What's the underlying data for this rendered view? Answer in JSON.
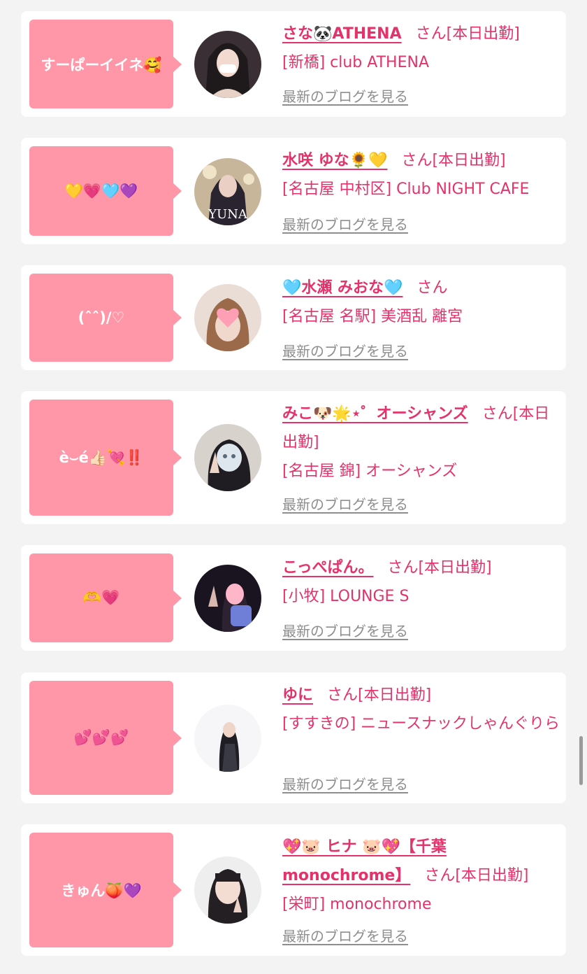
{
  "cards": [
    {
      "bubble": "すーぱーイイネ🥰",
      "name": "さな🐼ATHENA",
      "san": "さん[本日出勤]",
      "shop": "[新橋] club ATHENA",
      "blog": "最新のブログを見る"
    },
    {
      "bubble": "💛💗🩵💜",
      "name": "水咲 ゆな🌻💛",
      "san": "さん[本日出勤]",
      "shop": "[名古屋 中村区] Club NIGHT CAFE",
      "blog": "最新のブログを見る"
    },
    {
      "bubble": "(ˆˆ)/♡",
      "name": "🩵水瀬 みおな🩵",
      "san": "さん",
      "shop": "[名古屋 名駅] 美酒乱 離宮",
      "blog": "最新のブログを見る"
    },
    {
      "bubble": "è⌣é👍🏻💘‼️",
      "name": "みこ🐶🌟⋆゜オーシャンズ",
      "san": "さん[本日出勤]",
      "shop": "[名古屋 錦] オーシャンズ",
      "blog": "最新のブログを見る"
    },
    {
      "bubble": "🫶💗",
      "name": "こっぺぱん。",
      "san": "さん[本日出勤]",
      "shop": "[小牧] LOUNGE S",
      "blog": "最新のブログを見る"
    },
    {
      "bubble": "💕💕💕",
      "name": "ゆに",
      "san": "さん[本日出勤]",
      "shop": "[すすきの] ニュースナックしゃんぐりら",
      "blog": "最新のブログを見る"
    },
    {
      "bubble": "きゅん🍑💜",
      "name": "💖🐷 ヒナ 🐷💖【千葉monochrome】",
      "san": "さん[本日出勤]",
      "shop": "[栄町] monochrome",
      "blog": "最新のブログを見る"
    }
  ],
  "avatars": [
    "photo-avatar-1",
    "photo-avatar-2",
    "photo-avatar-3",
    "photo-avatar-4",
    "photo-avatar-5",
    "photo-avatar-6",
    "photo-avatar-7"
  ],
  "avatar2_text": "YUNA",
  "colors": {
    "accent": "#e3336a",
    "bubble": "#ff97a8",
    "link_gray": "#8e8e8e",
    "bg": "#f3f3f3"
  }
}
